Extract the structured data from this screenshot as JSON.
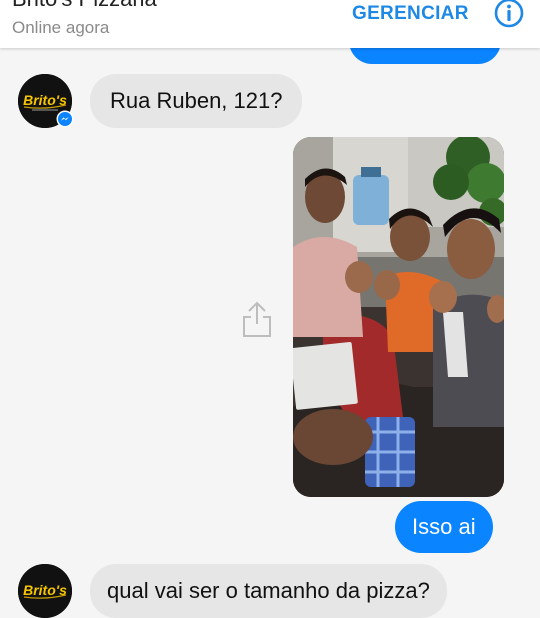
{
  "header": {
    "contact_name": "Brito's Pizzaria",
    "status": "Online agora",
    "manage_label": "GERENCIAR",
    "info_icon": "info-icon"
  },
  "avatar": {
    "logo_text": "Brito's",
    "badge_icon": "messenger-badge-icon"
  },
  "messages": [
    {
      "from": "contact",
      "text": "Rua Ruben, 121?"
    },
    {
      "from": "me",
      "type": "photo",
      "share_icon": "share-icon"
    },
    {
      "from": "me",
      "text": "Isso ai"
    },
    {
      "from": "contact",
      "text": "qual vai ser o tamanho da pizza?"
    }
  ],
  "colors": {
    "outgoing_bubble": "#0a84ff",
    "incoming_bubble": "#e6e6e6",
    "accent": "#1e88e5",
    "logo_yellow": "#f7c600"
  }
}
